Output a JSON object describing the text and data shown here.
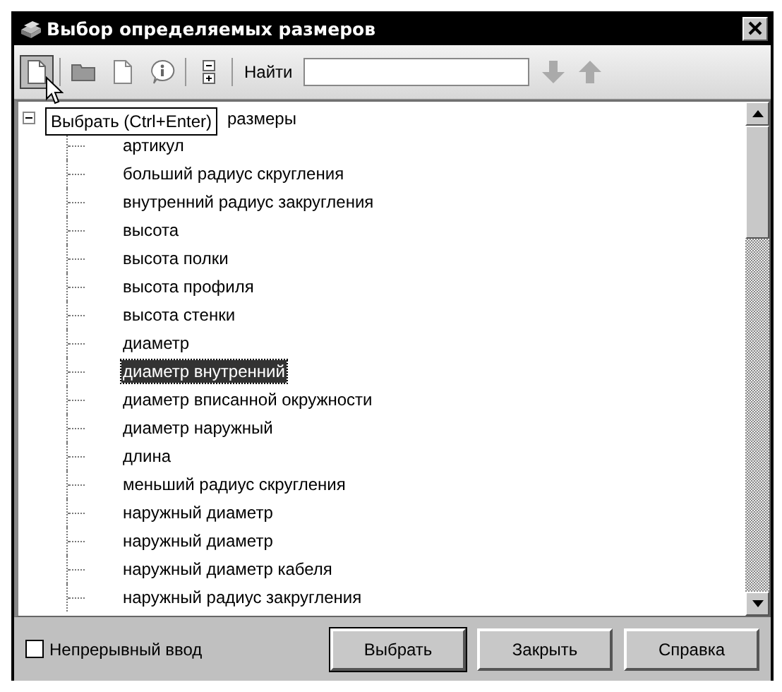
{
  "window": {
    "title": "Выбор определяемых размеров"
  },
  "toolbar": {
    "find_label": "Найти",
    "tooltip": "Выбрать (Ctrl+Enter)"
  },
  "tree": {
    "label": "размеры",
    "expanded": true,
    "children": [
      {
        "label": "артикул",
        "selected": false
      },
      {
        "label": "больший радиус скругления",
        "selected": false
      },
      {
        "label": "внутренний радиус закругления",
        "selected": false
      },
      {
        "label": "высота",
        "selected": false
      },
      {
        "label": "высота полки",
        "selected": false
      },
      {
        "label": "высота профиля",
        "selected": false
      },
      {
        "label": "высота стенки",
        "selected": false
      },
      {
        "label": "диаметр",
        "selected": false
      },
      {
        "label": "диаметр внутренний",
        "selected": true
      },
      {
        "label": "диаметр вписанной окружности",
        "selected": false
      },
      {
        "label": "диаметр наружный",
        "selected": false
      },
      {
        "label": "длина",
        "selected": false
      },
      {
        "label": "меньший радиус скругления",
        "selected": false
      },
      {
        "label": "наружный диаметр",
        "selected": false
      },
      {
        "label": "наружный диаметр",
        "selected": false
      },
      {
        "label": "наружный диаметр кабеля",
        "selected": false
      },
      {
        "label": "наружный радиус закругления",
        "selected": false
      }
    ]
  },
  "continuous_input": {
    "label": "Непрерывный ввод",
    "checked": false
  },
  "buttons": [
    {
      "label": "Выбрать",
      "default": true
    },
    {
      "label": "Закрыть",
      "default": false
    },
    {
      "label": "Справка",
      "default": false
    }
  ]
}
